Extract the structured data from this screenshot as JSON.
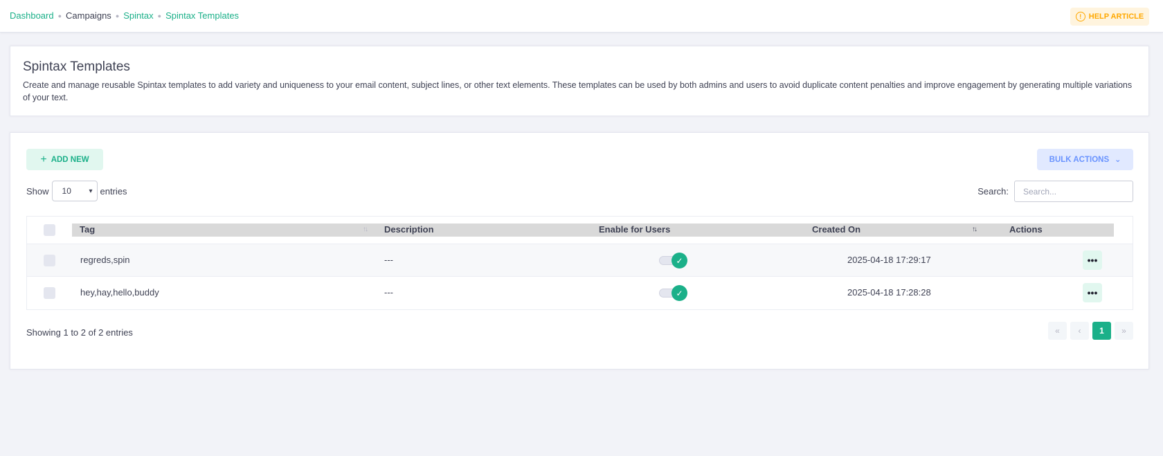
{
  "breadcrumb": [
    {
      "label": "Dashboard",
      "link": true
    },
    {
      "label": "Campaigns",
      "link": false
    },
    {
      "label": "Spintax",
      "link": true
    },
    {
      "label": "Spintax Templates",
      "link": true
    }
  ],
  "help": {
    "label": "HELP ARTICLE",
    "icon": "alert-circle-icon"
  },
  "intro": {
    "title": "Spintax Templates",
    "description": "Create and manage reusable Spintax templates to add variety and uniqueness to your email content, subject lines, or other text elements. These templates can be used by both admins and users to avoid duplicate content penalties and improve engagement by generating multiple variations of your text."
  },
  "toolbar": {
    "add_label": "ADD NEW",
    "bulk_label": "BULK ACTIONS",
    "show_label": "Show",
    "entries_value": "10",
    "entries_label": "entries",
    "search_label": "Search:",
    "search_placeholder": "Search..."
  },
  "table": {
    "columns": {
      "tag": "Tag",
      "description": "Description",
      "enable": "Enable for Users",
      "created": "Created On",
      "actions": "Actions"
    },
    "rows": [
      {
        "tag": "regreds,spin",
        "description": "---",
        "enabled": true,
        "created": "2025-04-18 17:29:17"
      },
      {
        "tag": "hey,hay,hello,buddy",
        "description": "---",
        "enabled": true,
        "created": "2025-04-18 17:28:28"
      }
    ]
  },
  "footer": {
    "info": "Showing 1 to 2 of 2 entries",
    "current_page": "1"
  },
  "colors": {
    "accent": "#1bb089",
    "warning": "#ffa800",
    "primary_light": "#6993ff"
  }
}
